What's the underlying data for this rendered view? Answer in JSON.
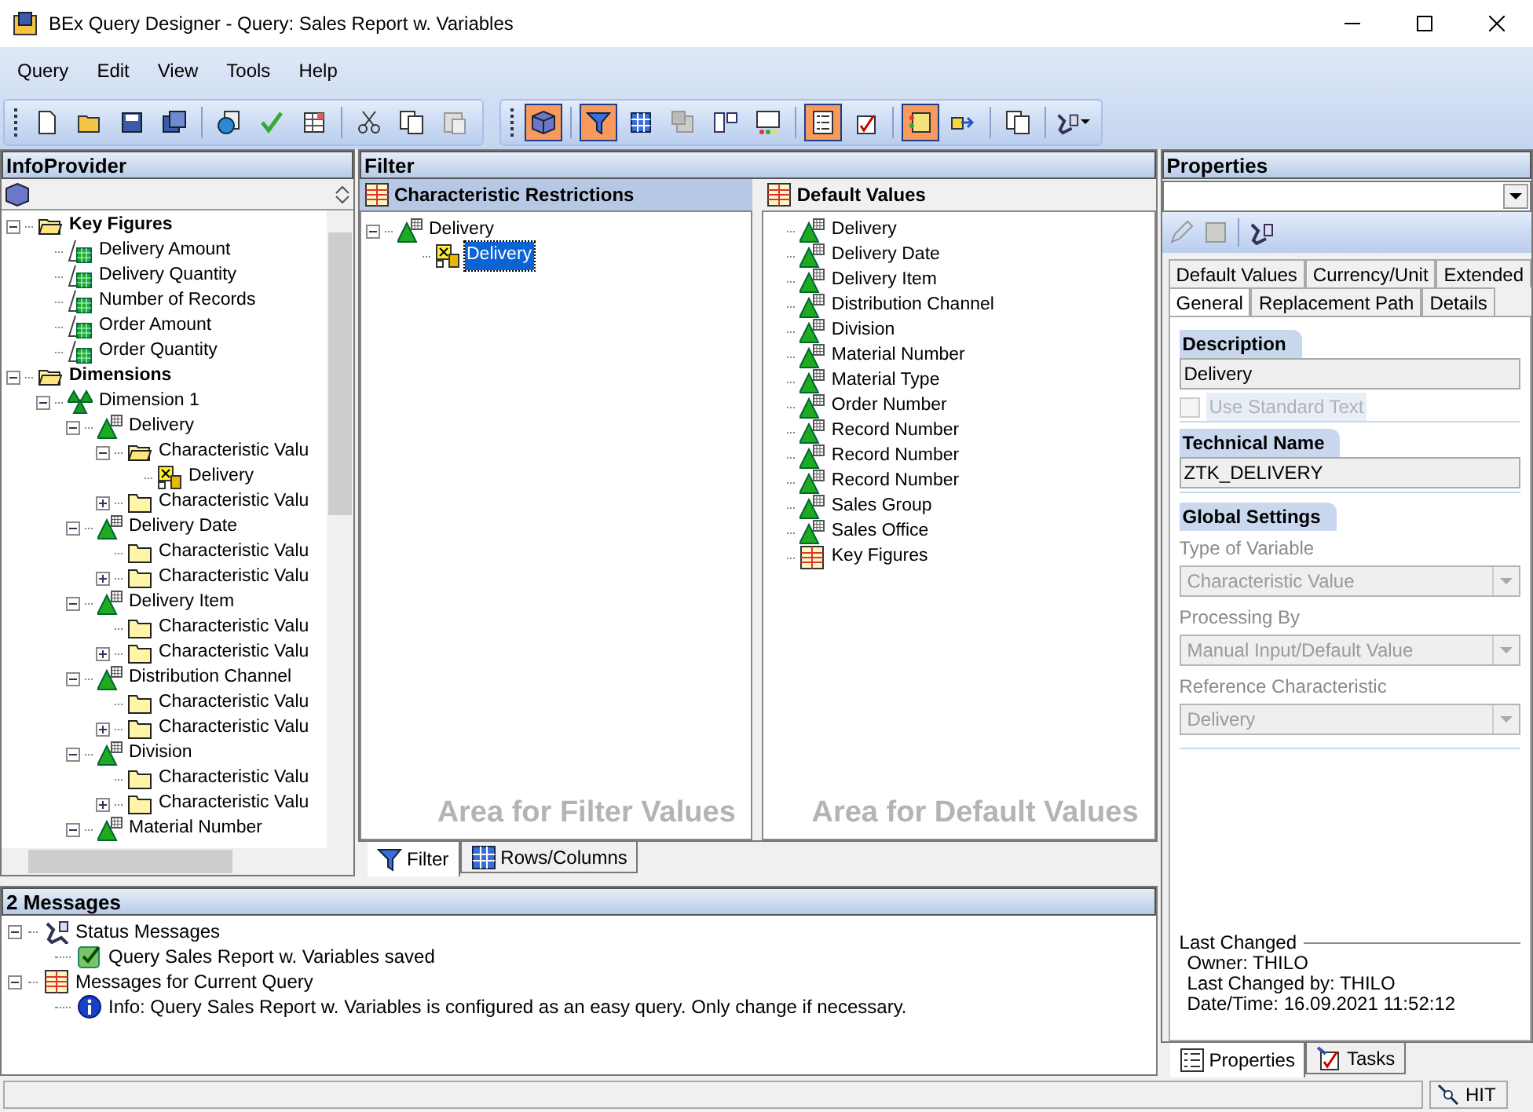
{
  "window": {
    "title": "BEx Query Designer - Query: Sales Report w. Variables"
  },
  "menu": [
    "Query",
    "Edit",
    "View",
    "Tools",
    "Help"
  ],
  "toolbar_left": [
    {
      "kind": "new",
      "active": false
    },
    {
      "kind": "open",
      "active": false
    },
    {
      "kind": "save",
      "active": false
    },
    {
      "kind": "saveall",
      "active": false
    },
    {
      "kind": "sep"
    },
    {
      "kind": "globe",
      "active": false
    },
    {
      "kind": "check",
      "active": false
    },
    {
      "kind": "props",
      "active": false
    },
    {
      "kind": "sep"
    },
    {
      "kind": "cut",
      "active": false
    },
    {
      "kind": "copy",
      "active": false
    },
    {
      "kind": "paste",
      "active": false
    }
  ],
  "toolbar_right": [
    {
      "kind": "cube",
      "active": true
    },
    {
      "kind": "sep"
    },
    {
      "kind": "filter",
      "active": true
    },
    {
      "kind": "grid",
      "active": false
    },
    {
      "kind": "cells",
      "active": false
    },
    {
      "kind": "cols",
      "active": false
    },
    {
      "kind": "screen",
      "active": false
    },
    {
      "kind": "sep"
    },
    {
      "kind": "list",
      "active": true
    },
    {
      "kind": "task",
      "active": false
    },
    {
      "kind": "sep"
    },
    {
      "kind": "msgs",
      "active": true
    },
    {
      "kind": "export",
      "active": false
    },
    {
      "kind": "sep"
    },
    {
      "kind": "copy",
      "active": false
    },
    {
      "kind": "sep"
    },
    {
      "kind": "tools",
      "active": false
    }
  ],
  "infoprovider": {
    "title": "InfoProvider",
    "tree": [
      {
        "label": "Key Figures",
        "kind": "folder",
        "bold": true,
        "expanded": true,
        "children": [
          {
            "label": "Delivery Amount",
            "kind": "keyfigure"
          },
          {
            "label": "Delivery Quantity",
            "kind": "keyfigure"
          },
          {
            "label": "Number of Records",
            "kind": "keyfigure"
          },
          {
            "label": "Order Amount",
            "kind": "keyfigure"
          },
          {
            "label": "Order Quantity",
            "kind": "keyfigure"
          }
        ]
      },
      {
        "label": "Dimensions",
        "kind": "folder",
        "bold": true,
        "expanded": true,
        "children": [
          {
            "label": "Dimension 1",
            "kind": "dimension",
            "expanded": true,
            "children": [
              {
                "label": "Delivery",
                "kind": "characteristic",
                "expanded": true,
                "children": [
                  {
                    "label": "Characteristic Valu",
                    "kind": "openfolder",
                    "expanded": true,
                    "children": [
                      {
                        "label": "Delivery",
                        "kind": "variable"
                      }
                    ]
                  },
                  {
                    "label": "Characteristic Valu",
                    "kind": "closedfolder",
                    "expanded": false
                  }
                ]
              },
              {
                "label": "Delivery Date",
                "kind": "characteristic",
                "expanded": true,
                "children": [
                  {
                    "label": "Characteristic Valu",
                    "kind": "closedfolder"
                  },
                  {
                    "label": "Characteristic Valu",
                    "kind": "closedfolder",
                    "expanded": false
                  }
                ]
              },
              {
                "label": "Delivery Item",
                "kind": "characteristic",
                "expanded": true,
                "children": [
                  {
                    "label": "Characteristic Valu",
                    "kind": "closedfolder"
                  },
                  {
                    "label": "Characteristic Valu",
                    "kind": "closedfolder",
                    "expanded": false
                  }
                ]
              },
              {
                "label": "Distribution Channel",
                "kind": "characteristic",
                "expanded": true,
                "children": [
                  {
                    "label": "Characteristic Valu",
                    "kind": "closedfolder"
                  },
                  {
                    "label": "Characteristic Valu",
                    "kind": "closedfolder",
                    "expanded": false
                  }
                ]
              },
              {
                "label": "Division",
                "kind": "characteristic",
                "expanded": true,
                "children": [
                  {
                    "label": "Characteristic Valu",
                    "kind": "closedfolder"
                  },
                  {
                    "label": "Characteristic Valu",
                    "kind": "closedfolder",
                    "expanded": false
                  }
                ]
              },
              {
                "label": "Material Number",
                "kind": "characteristic",
                "expanded": true
              }
            ]
          }
        ]
      }
    ]
  },
  "filter": {
    "title": "Filter",
    "restrictions": {
      "title": "Characteristic Restrictions",
      "hint": "Area for Filter Values",
      "tree": [
        {
          "label": "Delivery",
          "kind": "characteristic",
          "expanded": true,
          "children": [
            {
              "label": "Delivery",
              "kind": "variable",
              "selected": true
            }
          ]
        }
      ]
    },
    "defaults": {
      "title": "Default Values",
      "hint": "Area for Default Values",
      "tree": [
        {
          "label": "Delivery",
          "kind": "characteristic"
        },
        {
          "label": "Delivery Date",
          "kind": "characteristic"
        },
        {
          "label": "Delivery Item",
          "kind": "characteristic"
        },
        {
          "label": "Distribution Channel",
          "kind": "characteristic"
        },
        {
          "label": "Division",
          "kind": "characteristic"
        },
        {
          "label": "Material Number",
          "kind": "characteristic"
        },
        {
          "label": "Material Type",
          "kind": "characteristic"
        },
        {
          "label": "Order Number",
          "kind": "characteristic"
        },
        {
          "label": "Record Number",
          "kind": "characteristic"
        },
        {
          "label": "Record Number",
          "kind": "characteristic"
        },
        {
          "label": "Record Number",
          "kind": "characteristic"
        },
        {
          "label": "Sales Group",
          "kind": "characteristic"
        },
        {
          "label": "Sales Office",
          "kind": "characteristic"
        },
        {
          "label": "Key Figures",
          "kind": "structure"
        }
      ]
    },
    "tabs": [
      {
        "label": "Filter",
        "kind": "filter",
        "selected": true
      },
      {
        "label": "Rows/Columns",
        "kind": "grid",
        "selected": false
      }
    ]
  },
  "properties": {
    "title": "Properties",
    "tab_rows": [
      [
        {
          "label": "Default Values",
          "selected": false
        },
        {
          "label": "Currency/Unit",
          "selected": false
        },
        {
          "label": "Extended",
          "selected": false
        }
      ],
      [
        {
          "label": "General",
          "selected": true
        },
        {
          "label": "Replacement Path",
          "selected": false
        },
        {
          "label": "Details",
          "selected": false
        }
      ]
    ],
    "description": {
      "title": "Description",
      "value": "Delivery",
      "use_standard_text": {
        "label": "Use Standard Text",
        "checked": false,
        "disabled": true
      }
    },
    "technical_name": {
      "title": "Technical Name",
      "value": "ZTK_DELIVERY"
    },
    "global_settings": {
      "title": "Global Settings",
      "fields": [
        {
          "label": "Type of Variable",
          "value": "Characteristic Value"
        },
        {
          "label": "Processing By",
          "value": "Manual Input/Default Value"
        },
        {
          "label": "Reference Characteristic",
          "value": "Delivery"
        }
      ]
    },
    "last_changed": {
      "title": "Last Changed",
      "lines": [
        "Owner: THILO",
        "Last Changed by: THILO",
        "Date/Time: 16.09.2021 11:52:12"
      ]
    },
    "tabs": [
      {
        "label": "Properties",
        "kind": "list",
        "selected": true
      },
      {
        "label": "Tasks",
        "kind": "task",
        "selected": false
      }
    ]
  },
  "messages": {
    "title": "2 Messages",
    "groups": [
      {
        "label": "Status Messages",
        "kind": "tools",
        "items": [
          {
            "text": "Query Sales Report w. Variables saved",
            "kind": "success"
          }
        ]
      },
      {
        "label": "Messages for Current Query",
        "kind": "table",
        "items": [
          {
            "text": "Info: Query Sales Report w. Variables is configured as an easy query. Only change if necessary.",
            "kind": "info"
          }
        ]
      }
    ]
  },
  "status_bar": {
    "system": "HIT"
  }
}
